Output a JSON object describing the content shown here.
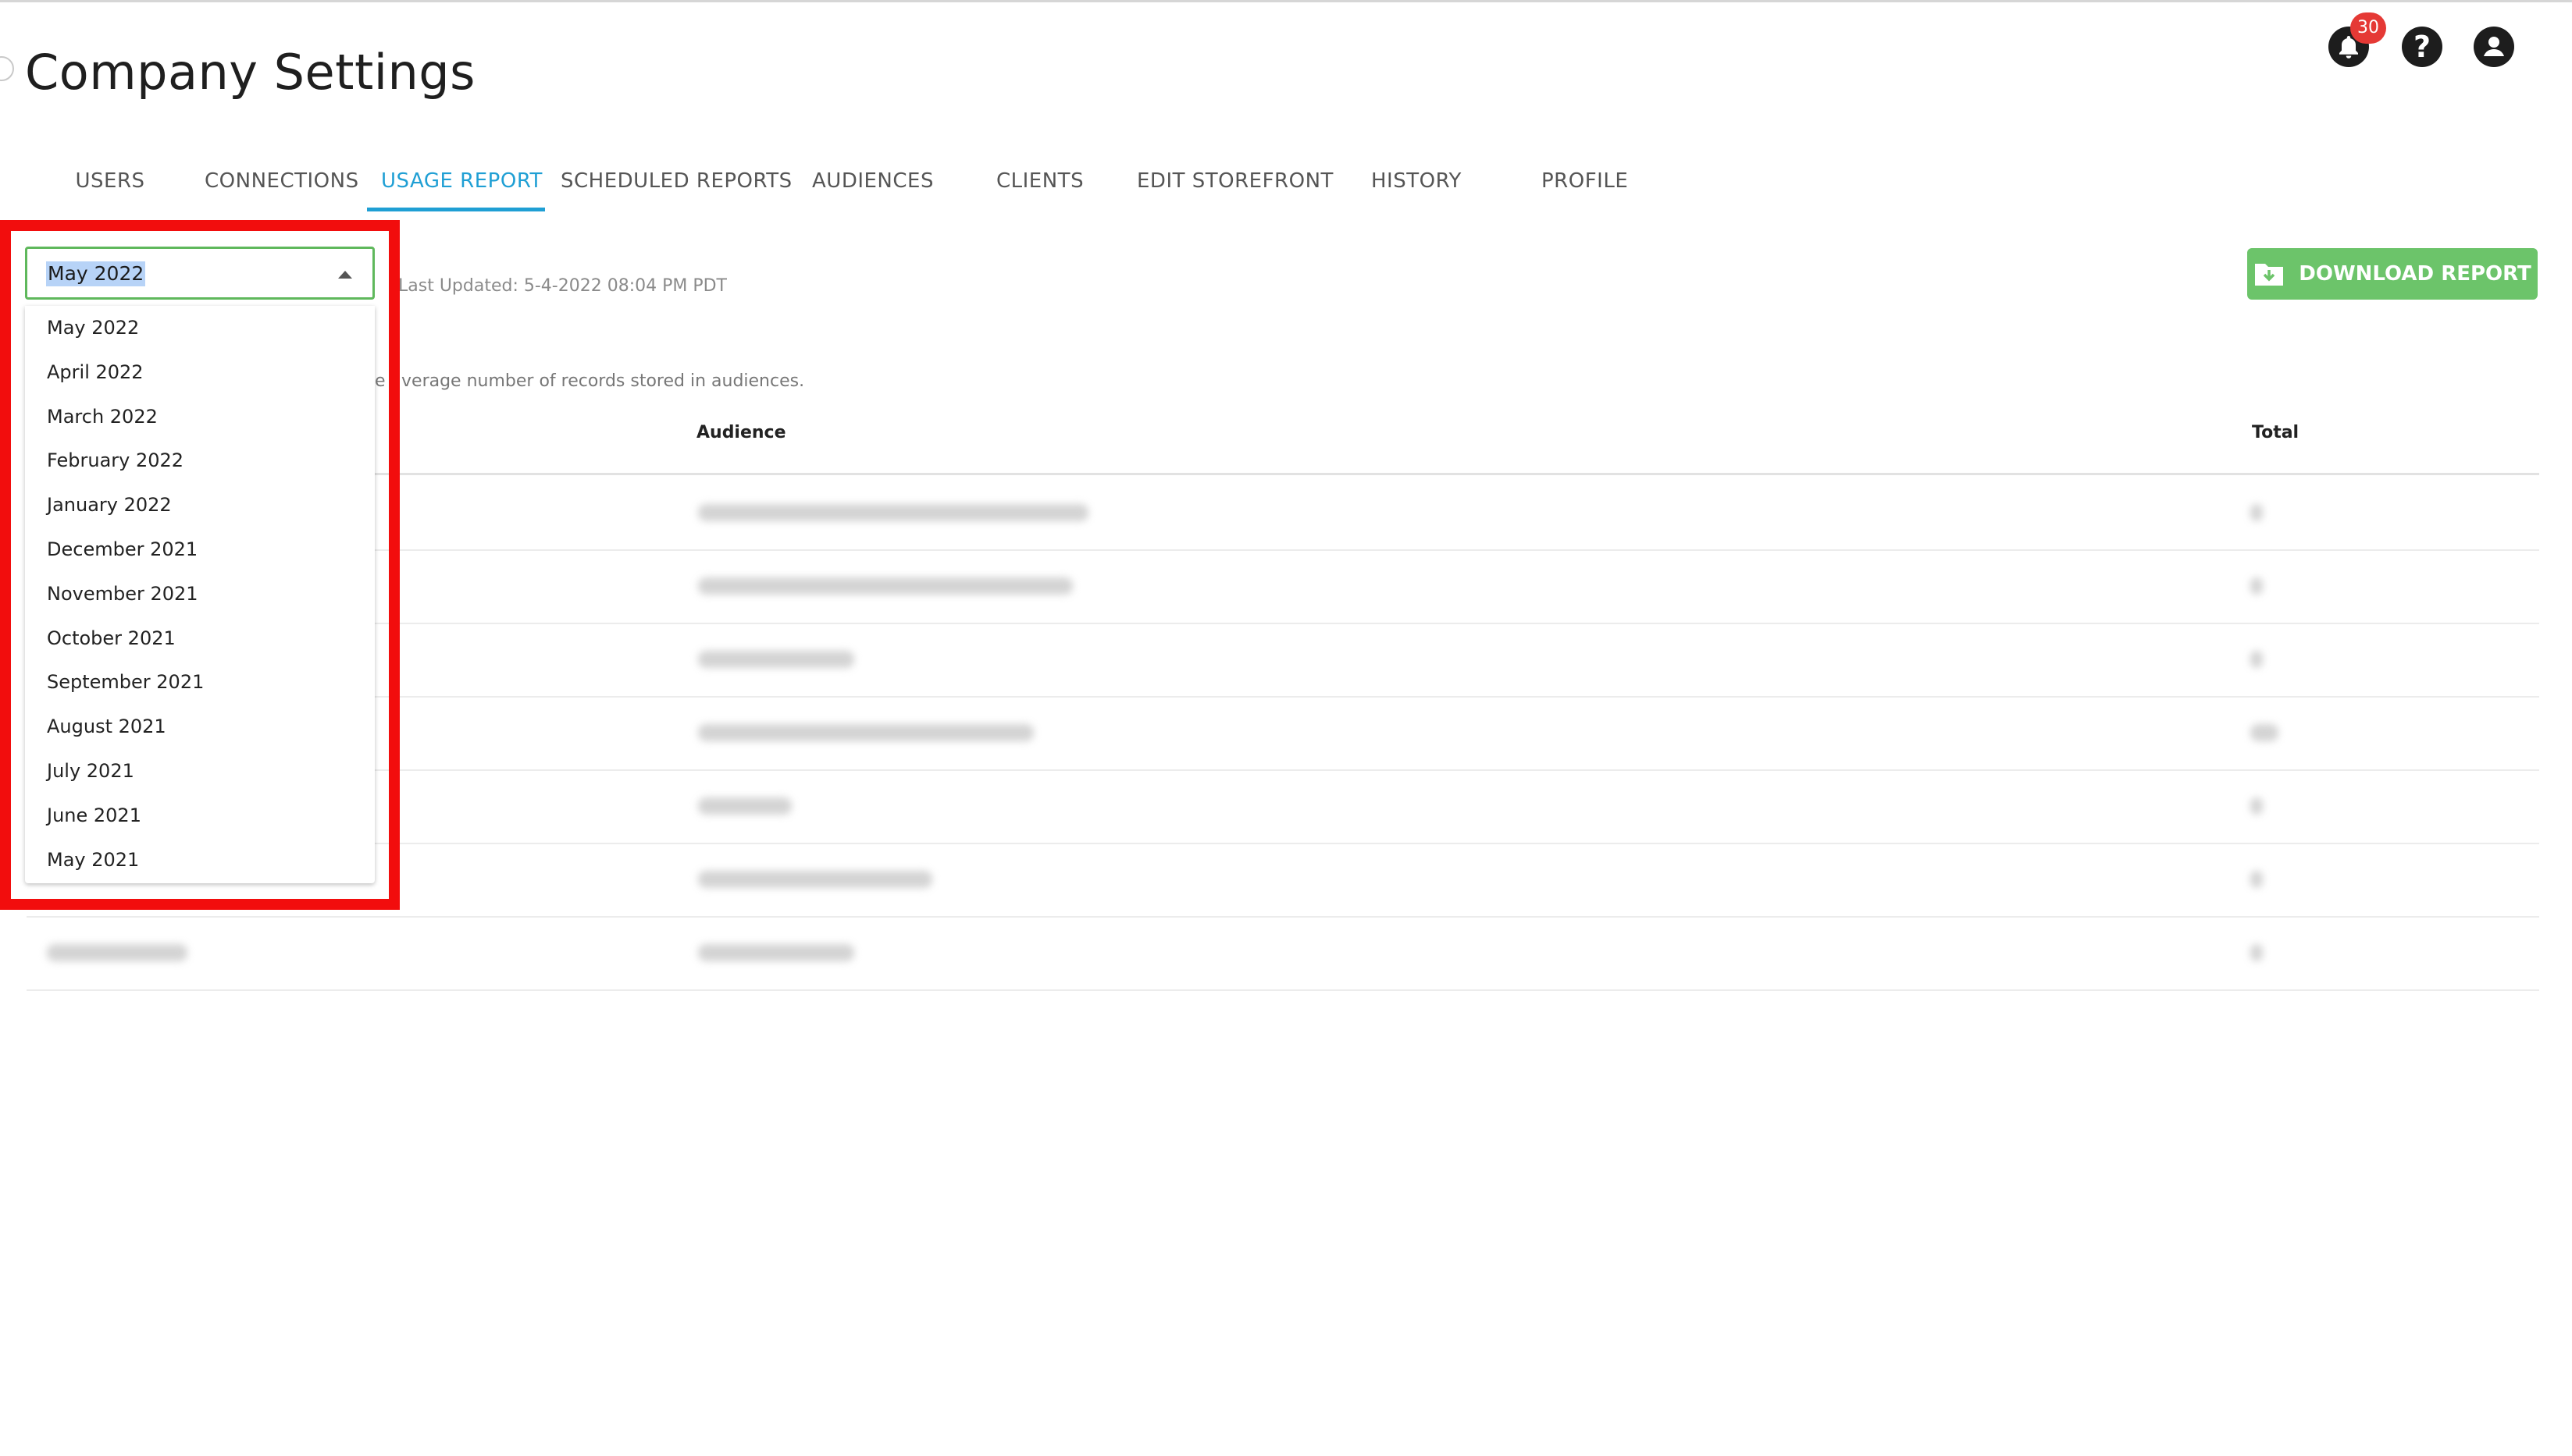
{
  "page": {
    "title": "Company Settings"
  },
  "header": {
    "notifications_count": "30",
    "help_glyph": "?"
  },
  "tabs": [
    {
      "label": "USERS"
    },
    {
      "label": "CONNECTIONS"
    },
    {
      "label": "USAGE REPORT"
    },
    {
      "label": "SCHEDULED REPORTS"
    },
    {
      "label": "AUDIENCES"
    },
    {
      "label": "CLIENTS"
    },
    {
      "label": "EDIT STOREFRONT"
    },
    {
      "label": "HISTORY"
    },
    {
      "label": "PROFILE"
    }
  ],
  "active_tab": "USAGE REPORT",
  "report": {
    "selected_month": "May 2022",
    "last_updated": "Last Updated: 5-4-2022 08:04 PM PDT",
    "download_label": "DOWNLOAD REPORT",
    "info_text": "e average number of records stored in audiences."
  },
  "month_options": [
    "May 2022",
    "April 2022",
    "March 2022",
    "February 2022",
    "January 2022",
    "December 2021",
    "November 2021",
    "October 2021",
    "September 2021",
    "August 2021",
    "July 2021",
    "June 2021",
    "May 2021"
  ],
  "table": {
    "columns": {
      "audience": "Audience",
      "total": "Total"
    }
  },
  "colors": {
    "accent_tab": "#1f9fd4",
    "download_button": "#6cc46a",
    "highlight_border": "#f20d0d",
    "badge": "#e53935"
  }
}
